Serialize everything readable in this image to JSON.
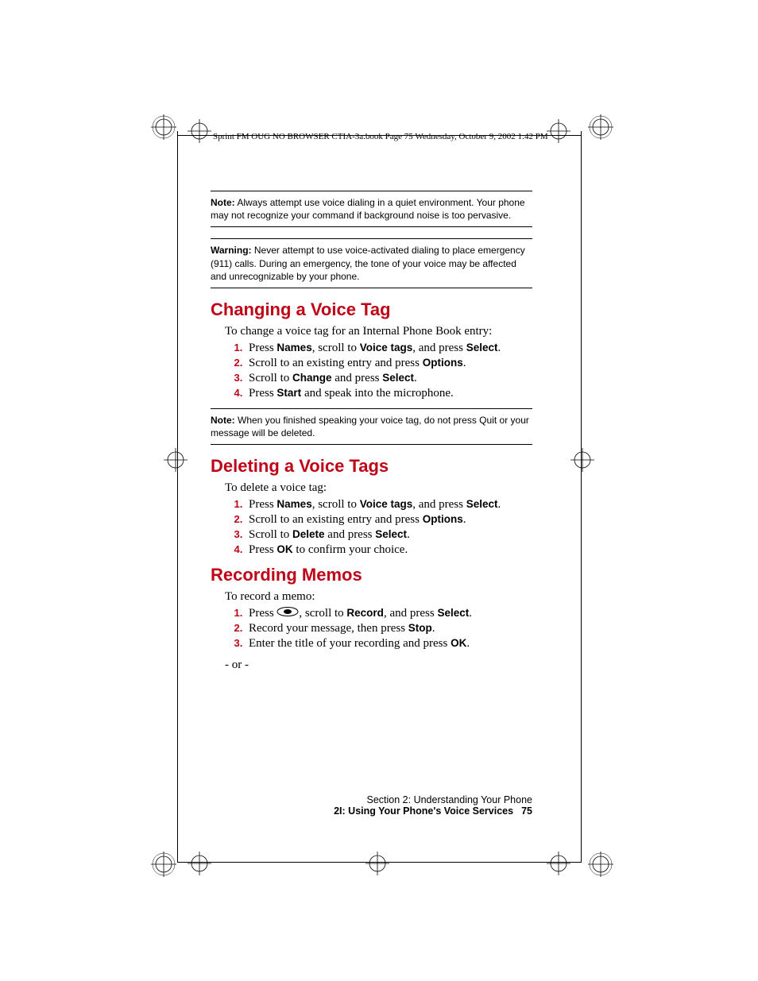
{
  "header": "Sprint FM OUG NO BROWSER CTIA-3a.book  Page 75  Wednesday, October 9, 2002  1:42 PM",
  "note1": {
    "label": "Note:",
    "text": " Always attempt use voice dialing in a quiet environment. Your phone may not recognize your command if background noise is too pervasive."
  },
  "warning": {
    "label": "Warning:",
    "text": " Never attempt to use voice-activated dialing to place emergency (911) calls. During an emergency, the tone of your voice may be affected and unrecognizable by your phone."
  },
  "section1": {
    "heading": "Changing a Voice Tag",
    "intro": "To change a voice tag for an Internal Phone Book entry:",
    "steps": {
      "s1a": "Press ",
      "s1b": "Names",
      "s1c": ", scroll to ",
      "s1d": "Voice tags",
      "s1e": ", and press ",
      "s1f": "Select",
      "s1g": ".",
      "s2a": "Scroll to an existing entry and press ",
      "s2b": "Options",
      "s2c": ".",
      "s3a": "Scroll to ",
      "s3b": "Change",
      "s3c": " and press ",
      "s3d": "Select",
      "s3e": ".",
      "s4a": "Press ",
      "s4b": "Start",
      "s4c": " and speak into the microphone."
    }
  },
  "note2": {
    "label": "Note:",
    "text": " When you finished speaking your voice tag, do not press Quit or your message will be deleted."
  },
  "section2": {
    "heading": "Deleting a Voice Tags",
    "intro": "To delete a voice tag:",
    "steps": {
      "s1a": "Press ",
      "s1b": "Names",
      "s1c": ", scroll to ",
      "s1d": "Voice tags",
      "s1e": ", and press ",
      "s1f": "Select",
      "s1g": ".",
      "s2a": "Scroll to an existing entry and press ",
      "s2b": "Options",
      "s2c": ".",
      "s3a": "Scroll to ",
      "s3b": "Delete",
      "s3c": " and press ",
      "s3d": "Select",
      "s3e": ".",
      "s4a": "Press ",
      "s4b": "OK",
      "s4c": " to confirm your choice."
    }
  },
  "section3": {
    "heading": "Recording Memos",
    "intro": "To record a memo:",
    "steps": {
      "s1a": "Press ",
      "s1b": ", scroll to ",
      "s1c": "Record",
      "s1d": ", and press ",
      "s1e": "Select",
      "s1f": ".",
      "s2a": "Record your message, then press ",
      "s2b": "Stop",
      "s2c": ".",
      "s3a": "Enter the title of your recording and press ",
      "s3b": "OK",
      "s3c": "."
    },
    "or": "- or -"
  },
  "footer": {
    "line1": "Section 2: Understanding Your Phone",
    "line2": "2I: Using Your Phone's Voice Services",
    "page": "75"
  }
}
